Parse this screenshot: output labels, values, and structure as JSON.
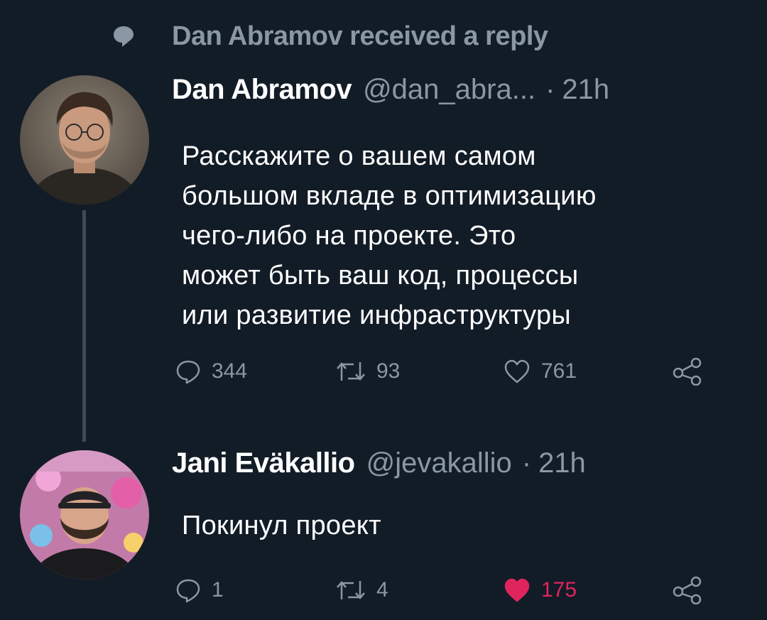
{
  "context": {
    "icon": "speech-bubble-icon",
    "text": "Dan Abramov received a reply"
  },
  "tweets": [
    {
      "author": {
        "name": "Dan Abramov",
        "handle": "@dan_abra...",
        "avatar": "avatar-photo"
      },
      "time": "21h",
      "separator": "·",
      "text": "Расскажите о вашем самом\nбольшом вкладе в оптимизацию\nчего-либо на проекте. Это\nможет быть ваш код, процессы\nили развитие инфраструктуры",
      "actions": {
        "reply": "344",
        "retweet": "93",
        "like": "761",
        "liked": false
      }
    },
    {
      "author": {
        "name": "Jani Eväkallio",
        "handle": "@jevakallio",
        "avatar": "avatar-photo"
      },
      "time": "21h",
      "separator": "·",
      "text": "Покинул проект",
      "actions": {
        "reply": "1",
        "retweet": "4",
        "like": "175",
        "liked": true
      }
    }
  ],
  "colors": {
    "background": "#121c27",
    "muted": "#8a97a4",
    "like_active": "#e0245e",
    "thread_line": "#3d4a56"
  }
}
